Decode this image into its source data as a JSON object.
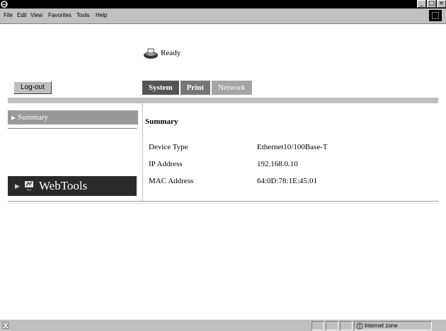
{
  "menubar": {
    "items": [
      "File",
      "Edit",
      "View",
      "Favorites",
      "Tools",
      "Help"
    ]
  },
  "window_buttons": {
    "minimize": "_",
    "maximize": "□",
    "close": "×"
  },
  "status": {
    "text": "Ready",
    "icon": "printer-icon"
  },
  "logout": {
    "label": "Log-out"
  },
  "tabs": [
    {
      "label": "System",
      "state": "active"
    },
    {
      "label": "Print",
      "state": "normal"
    },
    {
      "label": "Network",
      "state": "dim"
    }
  ],
  "sidebar": {
    "summary_label": "Summary",
    "webtools_label": "WebTools",
    "webtools_icon_caption": "hcy"
  },
  "panel": {
    "title": "Summary",
    "rows": [
      {
        "label": "Device Type",
        "value": "Ethernet10/100Base-T"
      },
      {
        "label": "IP Address",
        "value": "192.168.0.10"
      },
      {
        "label": "MAC Address",
        "value": "64:0D:78:1E:45:01"
      }
    ]
  },
  "statusbar": {
    "zone": "Internet zone"
  },
  "colors": {
    "titlebar": "#000000",
    "chrome": "#c0c0c0",
    "tab_active": "#555555",
    "tab_normal": "#777777",
    "tab_dim": "#a5a5a5",
    "sidebar_selected": "#999999",
    "webtools_bg": "#2a2a2a"
  }
}
